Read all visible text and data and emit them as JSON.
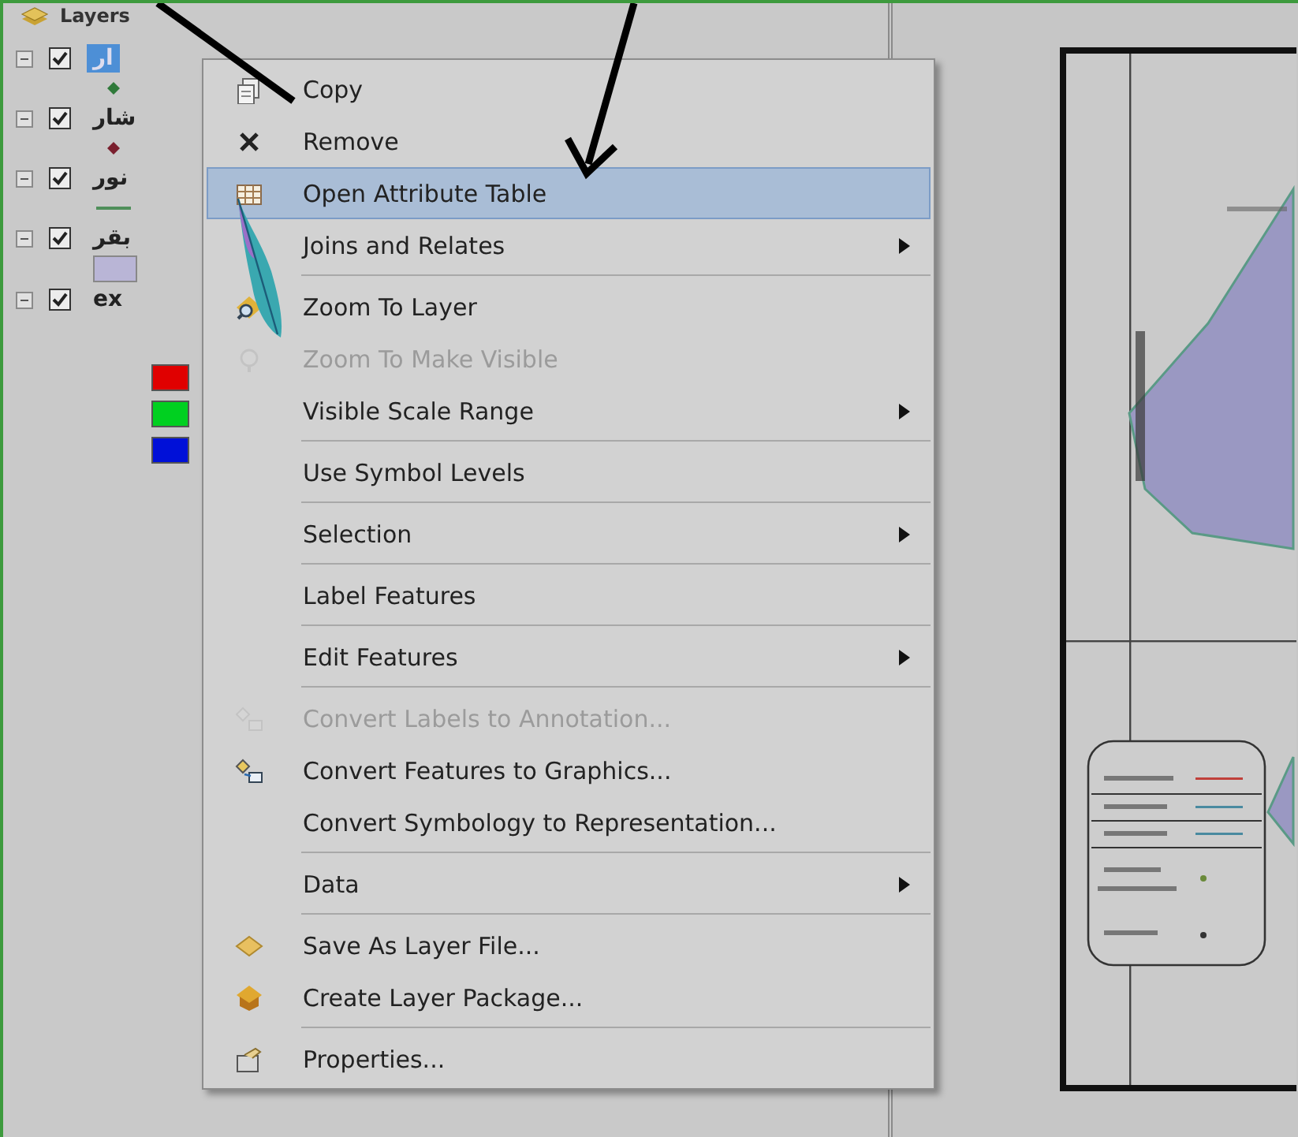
{
  "toc": {
    "title": "Layers",
    "layers": [
      {
        "name": "ار",
        "checked": true,
        "selected": true,
        "expanded": true,
        "symbols": [
          {
            "kind": "point",
            "color": "#2f7a3a"
          }
        ]
      },
      {
        "name": "شار",
        "checked": true,
        "selected": false,
        "expanded": true,
        "symbols": [
          {
            "kind": "point",
            "color": "#7a1f2e"
          }
        ]
      },
      {
        "name": "نور",
        "checked": true,
        "selected": false,
        "expanded": true,
        "symbols": [
          {
            "kind": "line",
            "color": "#4f8f5a"
          }
        ]
      },
      {
        "name": "بقر",
        "checked": true,
        "selected": false,
        "expanded": true,
        "symbols": [
          {
            "kind": "fill",
            "color": "#b9b5d6"
          }
        ]
      },
      {
        "name": "ex",
        "checked": true,
        "selected": false,
        "expanded": true,
        "symbols": [
          {
            "kind": "class",
            "color": "#e00000"
          },
          {
            "kind": "class",
            "color": "#00d020"
          },
          {
            "kind": "class",
            "color": "#0010d8"
          }
        ]
      }
    ]
  },
  "context_menu": {
    "groups": [
      [
        {
          "label": "Copy",
          "disabled": false,
          "highlighted": false,
          "submenu": false
        },
        {
          "label": "Remove",
          "disabled": false,
          "highlighted": false,
          "submenu": false
        },
        {
          "label": "Open Attribute Table",
          "disabled": false,
          "highlighted": true,
          "submenu": false
        },
        {
          "label": "Joins and Relates",
          "disabled": false,
          "highlighted": false,
          "submenu": true
        }
      ],
      [
        {
          "label": "Zoom To Layer",
          "disabled": false,
          "highlighted": false,
          "submenu": false
        },
        {
          "label": "Zoom To Make Visible",
          "disabled": true,
          "highlighted": false,
          "submenu": false
        },
        {
          "label": "Visible Scale Range",
          "disabled": false,
          "highlighted": false,
          "submenu": true
        }
      ],
      [
        {
          "label": "Use Symbol Levels",
          "disabled": false,
          "highlighted": false,
          "submenu": false
        }
      ],
      [
        {
          "label": "Selection",
          "disabled": false,
          "highlighted": false,
          "submenu": true
        }
      ],
      [
        {
          "label": "Label Features",
          "disabled": false,
          "highlighted": false,
          "submenu": false
        }
      ],
      [
        {
          "label": "Edit Features",
          "disabled": false,
          "highlighted": false,
          "submenu": true
        }
      ],
      [
        {
          "label": "Convert Labels to Annotation...",
          "disabled": true,
          "highlighted": false,
          "submenu": false
        },
        {
          "label": "Convert Features to Graphics...",
          "disabled": false,
          "highlighted": false,
          "submenu": false
        },
        {
          "label": "Convert Symbology to Representation...",
          "disabled": false,
          "highlighted": false,
          "submenu": false
        }
      ],
      [
        {
          "label": "Data",
          "disabled": false,
          "highlighted": false,
          "submenu": true
        }
      ],
      [
        {
          "label": "Save As Layer File...",
          "disabled": false,
          "highlighted": false,
          "submenu": false
        },
        {
          "label": "Create Layer Package...",
          "disabled": false,
          "highlighted": false,
          "submenu": false
        }
      ],
      [
        {
          "label": "Properties...",
          "disabled": false,
          "highlighted": false,
          "submenu": false
        }
      ]
    ]
  }
}
